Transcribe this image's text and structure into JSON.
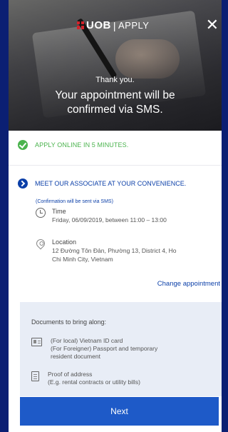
{
  "header": {
    "brand": "UOB",
    "separator": "|",
    "section": "APPLY",
    "close_icon": "close-icon",
    "thanks": "Thank you.",
    "confirm_line1": "Your appointment will be",
    "confirm_line2": "confirmed via SMS."
  },
  "steps": {
    "step1": {
      "icon": "check-circle-icon",
      "label": "APPLY ONLINE IN 5 MINUTES.",
      "color": "#4ab34d"
    },
    "step2": {
      "icon": "arrow-circle-icon",
      "label": "MEET OUR ASSOCIATE AT YOUR CONVENIENCE.",
      "color": "#0b3fa8"
    }
  },
  "appointment": {
    "note": "(Confirmation will be sent via SMS)",
    "time_label": "Time",
    "time_value": "Friday, 06/09/2019, between 11:00 – 13:00",
    "location_label": "Location",
    "location_line1": "12 Đường Tôn Đản, Phường 13, District 4, Ho",
    "location_line2": "Chi Minh City, Vietnam",
    "change_link": "Change appointment"
  },
  "documents": {
    "title": "Documents to bring along:",
    "items": [
      {
        "icon": "id-card-icon",
        "lines": [
          "(For local) Vietnam ID card",
          "(For Foreigner) Passport and temporary",
          "resident document"
        ]
      },
      {
        "icon": "document-icon",
        "lines": [
          "Proof of address",
          "(E.g. rental contracts or utility bills)"
        ]
      }
    ]
  },
  "footer": {
    "next_label": "Next",
    "button_color": "#1e5ac8"
  },
  "colors": {
    "background": "#0b1f73",
    "accent": "#0b3fa8",
    "success": "#4ab34d",
    "panel": "#e8edf6"
  }
}
